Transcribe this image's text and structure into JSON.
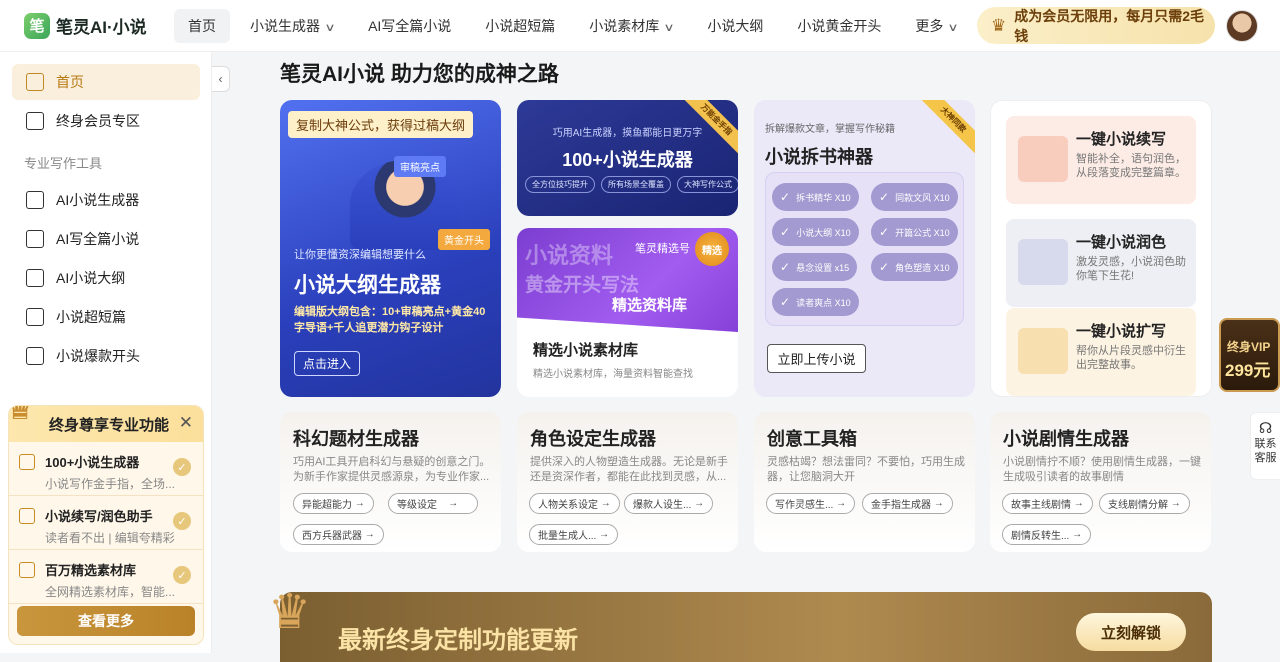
{
  "brand": {
    "name": "笔灵AI·小说",
    "mark": "笔"
  },
  "nav": [
    {
      "label": "首页",
      "active": true,
      "dropdown": false
    },
    {
      "label": "小说生成器",
      "dropdown": true
    },
    {
      "label": "AI写全篇小说",
      "dropdown": false
    },
    {
      "label": "小说超短篇",
      "dropdown": false
    },
    {
      "label": "小说素材库",
      "dropdown": true
    },
    {
      "label": "小说大纲",
      "dropdown": false
    },
    {
      "label": "小说黄金开头",
      "dropdown": false
    },
    {
      "label": "更多",
      "dropdown": true
    }
  ],
  "vip_pill": {
    "text": "成为会员无限用，每月只需2毛钱",
    "icon": "crown-icon"
  },
  "sidebar": {
    "items": [
      {
        "label": "首页",
        "icon": "home-icon"
      },
      {
        "label": "终身会员专区",
        "icon": "crown-icon"
      }
    ],
    "section": "专业写作工具",
    "tools": [
      {
        "label": "AI小说生成器",
        "icon": "book-icon"
      },
      {
        "label": "AI写全篇小说",
        "icon": "open-book-icon"
      },
      {
        "label": "AI小说大纲",
        "icon": "outline-book-icon"
      },
      {
        "label": "小说超短篇",
        "icon": "pages-icon"
      },
      {
        "label": "小说爆款开头",
        "icon": "opening-icon"
      }
    ]
  },
  "promo": {
    "title": "终身尊享专业功能",
    "rows": [
      {
        "title": "100+小说生成器",
        "sub": "小说写作金手指，全场..."
      },
      {
        "title": "小说续写/润色助手",
        "sub": "读者看不出 | 编辑夸精彩"
      },
      {
        "title": "百万精选素材库",
        "sub": "全网精选素材库，智能..."
      }
    ],
    "button": "查看更多"
  },
  "main": {
    "title": "笔灵AI小说 助力您的成神之路",
    "outline_card": {
      "tag": "复制大神公式，获得过稿大纲",
      "label1": "审稿亮点",
      "label2": "黄金开头",
      "sub": "让你更懂资深编辑想要什么",
      "title": "小说大纲生成器",
      "desc": "编辑版大纲包含：10+审稿亮点+黄金40字导语+千人追更潜力钩子设计",
      "button": "点击进入"
    },
    "generator_card": {
      "sub": "巧用AI生成器，摸鱼都能日更万字",
      "title": "100+小说生成器",
      "chips": [
        "全方位技巧提升",
        "所有场景全覆盖",
        "大神写作公式"
      ],
      "ribbon": "万能金手指"
    },
    "material_card": {
      "img_words": [
        "小说资料",
        "黄金开头写法",
        "精选资料库",
        "笔灵精选号"
      ],
      "seal": "精选",
      "title": "精选小说素材库",
      "desc": "精选小说素材库，海量资料智能查找"
    },
    "dismantle_card": {
      "sub": "拆解爆款文章，掌握写作秘籍",
      "title": "小说拆书神器",
      "ribbon": "大神同款",
      "chips": [
        "拆书精华 X10",
        "同款文风 X10",
        "小说大纲 X10",
        "开篇公式 X10",
        "悬念设置 x15",
        "角色塑造 X10",
        "读者爽点 X10"
      ],
      "button": "立即上传小说"
    },
    "tools": [
      {
        "title": "一键小说续写",
        "desc": "智能补全，语句润色，从段落变成完整篇章。",
        "color": "#fbe6df"
      },
      {
        "title": "一键小说润色",
        "desc": "激发灵感，小说润色助你笔下生花!",
        "color": "#eceef5"
      },
      {
        "title": "一键小说扩写",
        "desc": "帮你从片段灵感中衍生出完整故事。",
        "color": "#fdf1de"
      }
    ],
    "feature_cards": [
      {
        "title": "科幻题材生成器",
        "desc": "巧用AI工具开启科幻与悬疑的创意之门。为新手作家提供灵感源泉，为专业作家...",
        "chips": [
          "异能超能力",
          "等级设定",
          "西方兵器武器"
        ]
      },
      {
        "title": "角色设定生成器",
        "desc": "提供深入的人物塑造生成器。无论是新手还是资深作者，都能在此找到灵感，从...",
        "chips": [
          "人物关系设定",
          "爆款人设生...",
          "批量生成人..."
        ]
      },
      {
        "title": "创意工具箱",
        "desc": "灵感枯竭？想法雷同？不要怕，巧用生成器，让您脑洞大开",
        "chips": [
          "写作灵感生...",
          "金手指生成器"
        ]
      },
      {
        "title": "小说剧情生成器",
        "desc": "小说剧情拧不顺？使用剧情生成器，一键生成吸引读者的故事剧情",
        "chips": [
          "故事主线剧情",
          "支线剧情分解",
          "剧情反转生..."
        ]
      }
    ],
    "banner": {
      "title": "最新终身定制功能更新",
      "button": "立刻解锁"
    }
  },
  "float": {
    "vip_line1": "终身VIP",
    "vip_line2": "299元",
    "help": "联系客服"
  }
}
